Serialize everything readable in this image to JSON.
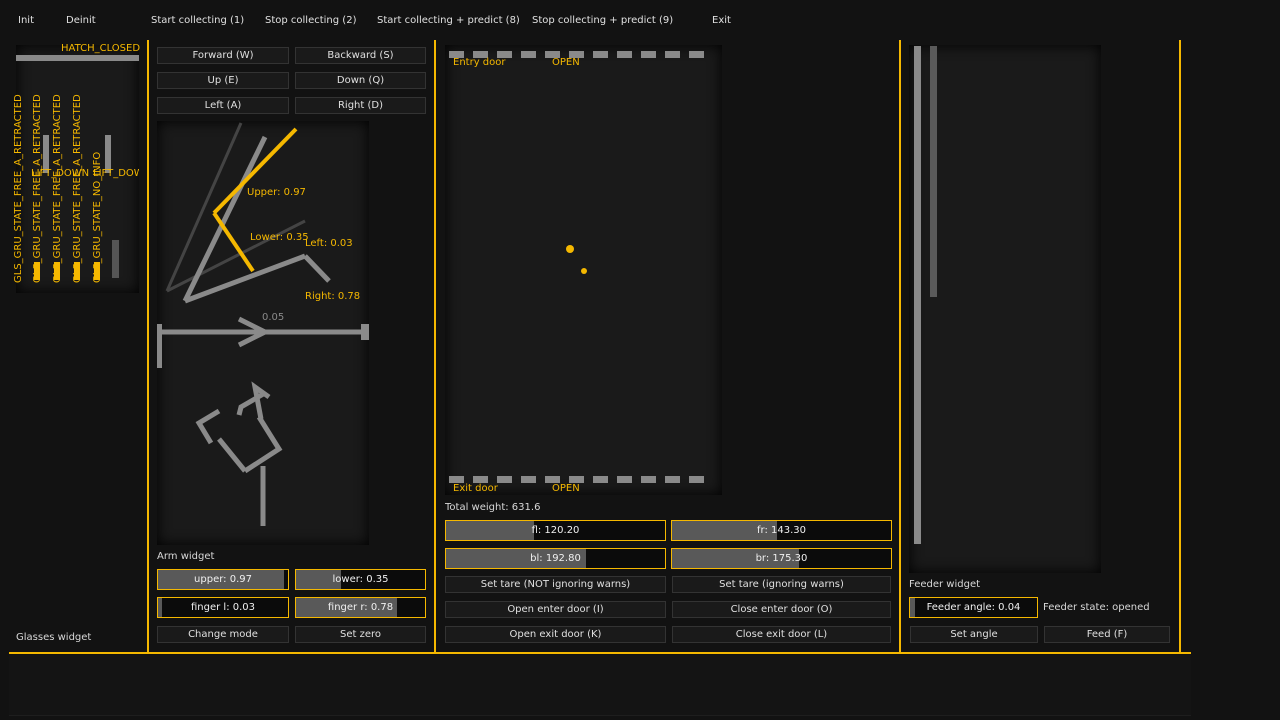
{
  "menu": {
    "items": [
      "Init",
      "Deinit",
      "Start collecting (1)",
      "Stop collecting (2)",
      "Start collecting + predict (8)",
      "Stop collecting + predict (9)",
      "Exit"
    ]
  },
  "glasses": {
    "hatch_label": "HATCH_CLOSED",
    "states": [
      "GLS_GRU_STATE_FREE_A_RETRACTED",
      "GLS_GRU_STATE_FREE_A_RETRACTED",
      "GLS_GRU_STATE_FREE_A_RETRACTED",
      "GLS_GRU_STATE_FREE_A_RETRACTED",
      "GLS_GRU_STATE_NO_INFO"
    ],
    "lift_labels": [
      "LIFT_DOWN",
      "LIFT_DOWN"
    ],
    "title": "Glasses widget"
  },
  "arm": {
    "buttons": [
      "Forward (W)",
      "Backward (S)",
      "Up (E)",
      "Down (Q)",
      "Left (A)",
      "Right (D)"
    ],
    "annotations": {
      "upper": "Upper: 0.97",
      "lower": "Lower: 0.35",
      "left": "Left: 0.03",
      "right": "Right: 0.78",
      "rail": "0.05"
    },
    "title": "Arm widget",
    "sliders": [
      {
        "label": "upper: 0.97",
        "value": 0.97
      },
      {
        "label": "lower: 0.35",
        "value": 0.35
      },
      {
        "label": "finger l: 0.03",
        "value": 0.03
      },
      {
        "label": "finger r: 0.78",
        "value": 0.78
      }
    ],
    "mode_button": "Change mode",
    "zero_button": "Set zero"
  },
  "scale": {
    "entry_door": "Entry door",
    "entry_state": "OPEN",
    "exit_door": "Exit door",
    "exit_state": "OPEN",
    "total_weight": "Total weight: 631.6",
    "sensors": [
      {
        "label": "fl: 120.20",
        "value": 0.4
      },
      {
        "label": "fr: 143.30",
        "value": 0.48
      },
      {
        "label": "bl: 192.80",
        "value": 0.64
      },
      {
        "label": "br: 175.30",
        "value": 0.58
      }
    ],
    "buttons": [
      "Set tare (NOT ignoring warns)",
      "Set tare (ignoring warns)",
      "Open enter door (I)",
      "Close enter door (O)",
      "Open exit door (K)",
      "Close exit door (L)"
    ]
  },
  "feeder": {
    "title": "Feeder widget",
    "angle_label": "Feeder angle: 0.04",
    "angle_value": 0.04,
    "state": "Feeder state: opened",
    "set_angle": "Set angle",
    "feed": "Feed (F)"
  },
  "colors": {
    "accent": "#f5b800",
    "gray": "#8a8a8a",
    "background": "#121212"
  }
}
